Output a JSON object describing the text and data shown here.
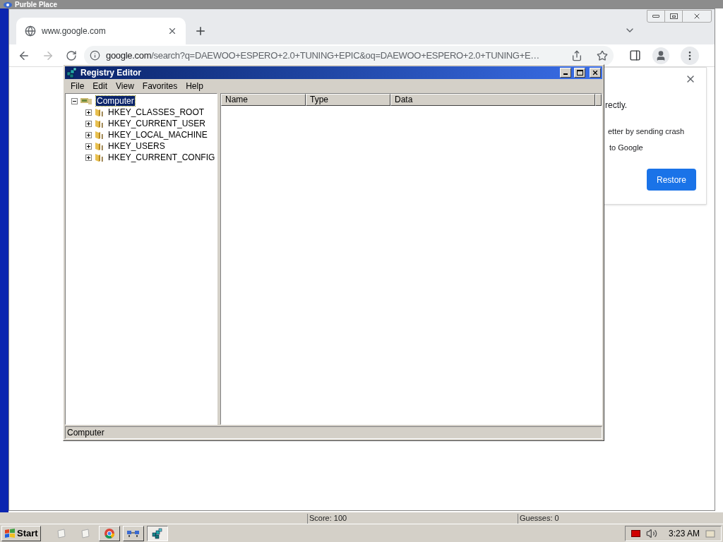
{
  "background_window": {
    "title": "Purble Place",
    "status_bar": [
      "Score: 100",
      "Guesses: 0"
    ]
  },
  "browser": {
    "tabs": [
      {
        "title": "www.google.com",
        "selected": true
      }
    ],
    "address": {
      "domain": "google.com",
      "path": "/search?q=DAEWOO+ESPERO+2.0+TUNING+EPIC&oq=DAEWOO+ESPERO+2.0+TUNING+E…"
    },
    "popup": {
      "lines": [
        "rectly.",
        "etter by sending crash",
        "to Google"
      ],
      "button": "Restore"
    }
  },
  "registry_editor": {
    "title": "Registry Editor",
    "menu": [
      "File",
      "Edit",
      "View",
      "Favorites",
      "Help"
    ],
    "tree": [
      {
        "label": "Computer",
        "selected": true,
        "expanded": true,
        "children": [
          {
            "label": "HKEY_CLASSES_ROOT",
            "selected": false,
            "expanded": false
          },
          {
            "label": "HKEY_CURRENT_USER",
            "selected": false,
            "expanded": false
          },
          {
            "label": "HKEY_LOCAL_MACHINE",
            "selected": false,
            "expanded": false
          },
          {
            "label": "HKEY_USERS",
            "selected": false,
            "expanded": false
          },
          {
            "label": "HKEY_CURRENT_CONFIG",
            "selected": false,
            "expanded": false
          }
        ]
      }
    ],
    "columns": [
      "Name",
      "Type",
      "Data"
    ],
    "status": "Computer"
  },
  "taskbar": {
    "start": "Start",
    "items": [
      {
        "kind": "note",
        "selected": false
      },
      {
        "kind": "note",
        "selected": false
      },
      {
        "kind": "chrome",
        "selected": false
      },
      {
        "kind": "network",
        "selected": false
      },
      {
        "kind": "regedit",
        "selected": true
      }
    ],
    "clock": "3:23 AM"
  }
}
